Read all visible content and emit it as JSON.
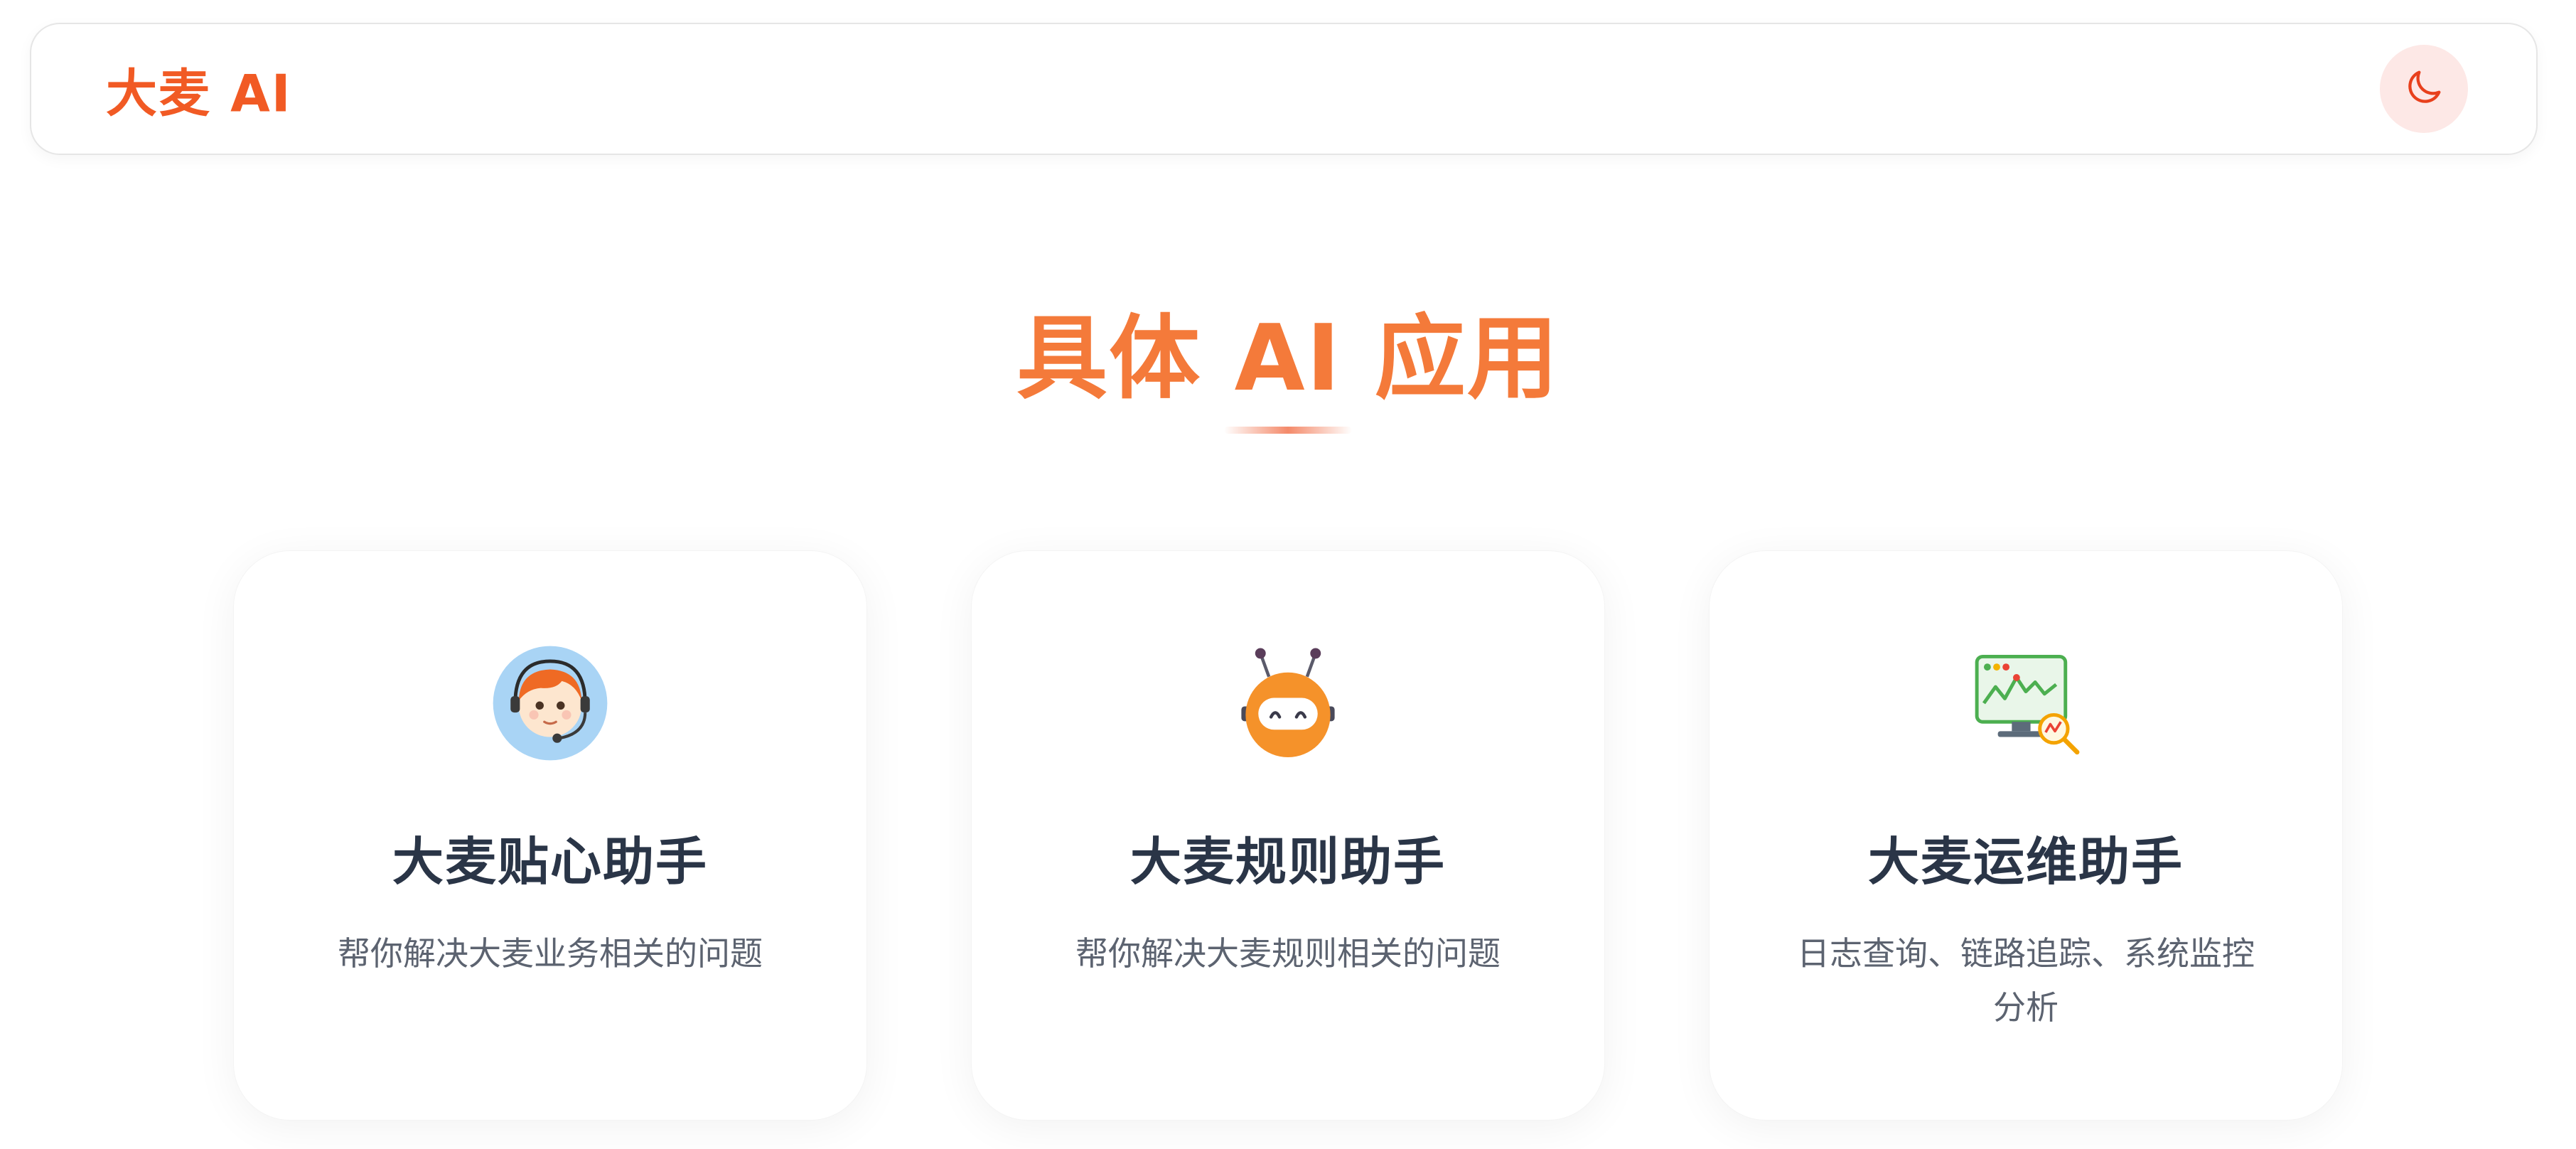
{
  "header": {
    "brand": "大麦 AI",
    "theme_toggle_icon": "moon-icon"
  },
  "section": {
    "title": "具体 AI 应用"
  },
  "cards": [
    {
      "icon": "customer-service-avatar-icon",
      "title": "大麦贴心助手",
      "description": "帮你解决大麦业务相关的问题"
    },
    {
      "icon": "robot-icon",
      "title": "大麦规则助手",
      "description": "帮你解决大麦规则相关的问题"
    },
    {
      "icon": "monitor-analytics-icon",
      "title": "大麦运维助手",
      "description": "日志查询、链路追踪、系统监控分析"
    }
  ],
  "colors": {
    "brand": "#f15a24",
    "title": "#f47a3a",
    "card_title": "#2a3547",
    "card_desc": "#5c6370",
    "toggle_bg": "#fde8e6"
  }
}
